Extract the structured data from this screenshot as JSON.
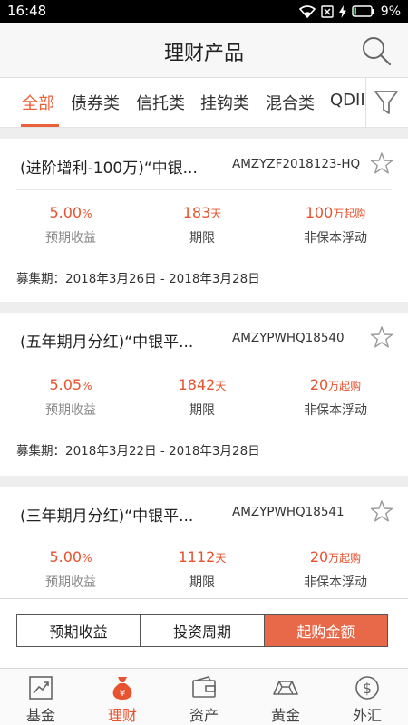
{
  "status": {
    "time": "16:48",
    "battery": "9%"
  },
  "header": {
    "title": "理财产品"
  },
  "tabs": [
    {
      "label": "全部",
      "active": true
    },
    {
      "label": "债券类"
    },
    {
      "label": "信托类"
    },
    {
      "label": "挂钩类"
    },
    {
      "label": "混合类"
    },
    {
      "label": "QDII"
    }
  ],
  "products": [
    {
      "name": "(进阶增利-100万)“中银...",
      "code": "AMZYZF2018123-HQ",
      "yield_value": "5.00",
      "yield_unit": "%",
      "yield_label": "预期收益",
      "term_value": "183",
      "term_unit": "天",
      "term_label": "期限",
      "min_value": "100",
      "min_unit": "万起购",
      "min_label": "非保本浮动",
      "period": "募集期：2018年3月26日 - 2018年3月28日"
    },
    {
      "name": "(五年期月分红)“中银平...",
      "code": "AMZYPWHQ18540",
      "yield_value": "5.05",
      "yield_unit": "%",
      "yield_label": "预期收益",
      "term_value": "1842",
      "term_unit": "天",
      "term_label": "期限",
      "min_value": "20",
      "min_unit": "万起购",
      "min_label": "非保本浮动",
      "period": "募集期：2018年3月22日 - 2018年3月28日"
    },
    {
      "name": "(三年期月分红)“中银平...",
      "code": "AMZYPWHQ18541",
      "yield_value": "5.00",
      "yield_unit": "%",
      "yield_label": "预期收益",
      "term_value": "1112",
      "term_unit": "天",
      "term_label": "期限",
      "min_value": "20",
      "min_unit": "万起购",
      "min_label": "非保本浮动",
      "period": ""
    }
  ],
  "sort": [
    {
      "label": "预期收益"
    },
    {
      "label": "投资周期"
    },
    {
      "label": "起购金额",
      "active": true
    }
  ],
  "nav": [
    {
      "label": "基金",
      "icon": "chart-icon"
    },
    {
      "label": "理财",
      "icon": "money-bag-icon",
      "active": true
    },
    {
      "label": "资产",
      "icon": "wallet-icon"
    },
    {
      "label": "黄金",
      "icon": "gold-bar-icon"
    },
    {
      "label": "外汇",
      "icon": "dollar-coin-icon"
    }
  ],
  "colors": {
    "accent": "#e8522e",
    "active_sort": "#e8684a"
  }
}
